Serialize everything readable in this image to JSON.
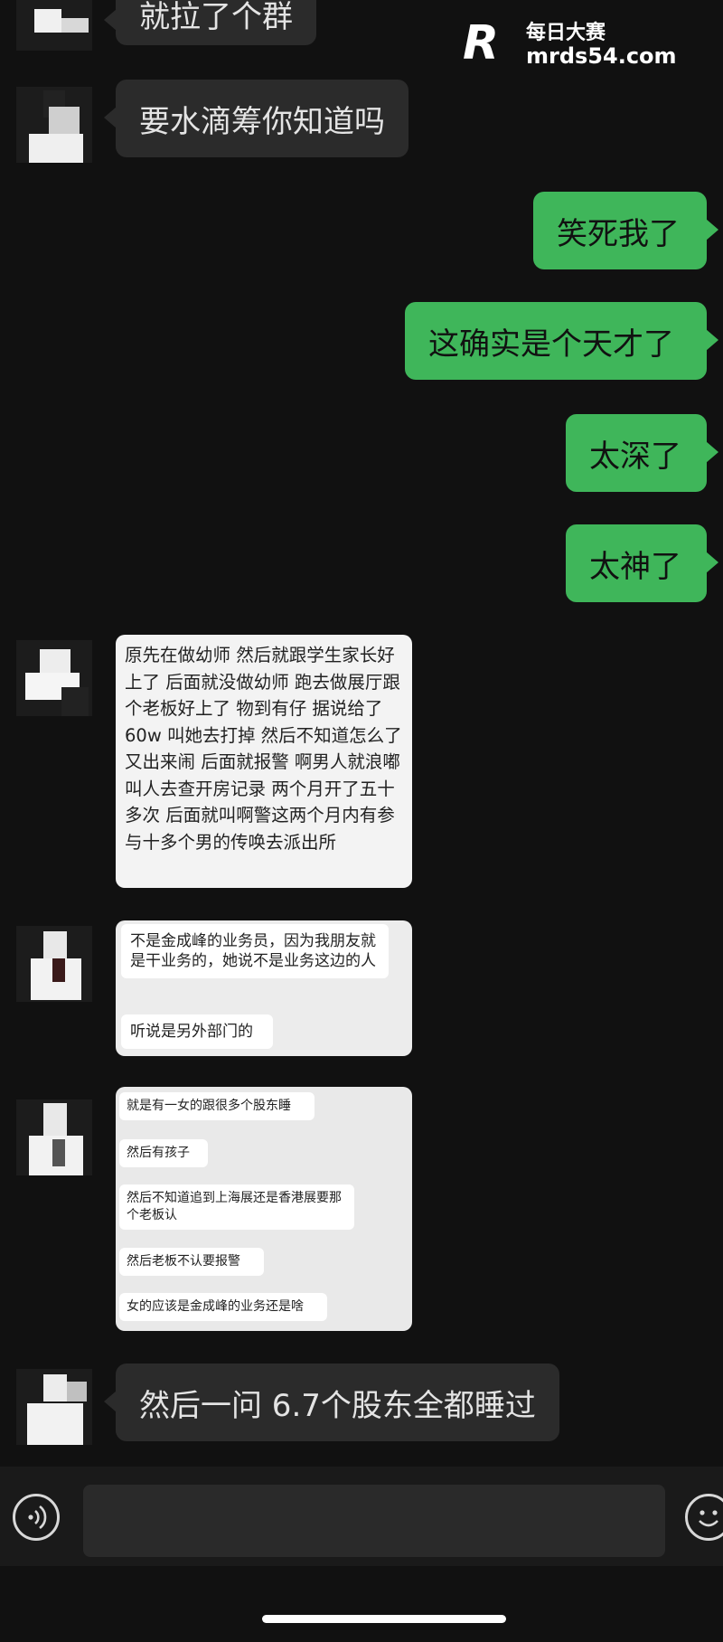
{
  "watermark": {
    "logo_letter": "R",
    "title": "每日大赛",
    "url": "mrds54.com"
  },
  "messages": {
    "m1": "就拉了个群",
    "m2": "要水滴筹你知道吗",
    "m3": "笑死我了",
    "m4": "这确实是个天才了",
    "m5": "太深了",
    "m6": "太神了",
    "m7": "原先在做幼师 然后就跟学生家长好上了 后面就没做幼师 跑去做展厅跟个老板好上了 物到有仔 据说给了60w 叫她去打掉 然后不知道怎么了又出来闹 后面就报警 啊男人就浪嘟叫人去查开房记录 两个月开了五十多次 后面就叫啊警这两个月内有参与十多个男的传唤去派出所",
    "m8a": "不是金成峰的业务员，因为我朋友就是干业务的，她说不是业务这边的人",
    "m8b": "听说是另外部门的",
    "m9a": "就是有一女的跟很多个股东睡",
    "m9b": "然后有孩子",
    "m9c": "然后不知道追到上海展还是香港展要那个老板认",
    "m9d": "然后老板不认要报警",
    "m9e": "女的应该是金成峰的业务还是啥",
    "m10": "然后一问 6.7个股东全都睡过"
  },
  "icons": {
    "voice": "voice-icon",
    "emoji": "emoji-icon"
  }
}
